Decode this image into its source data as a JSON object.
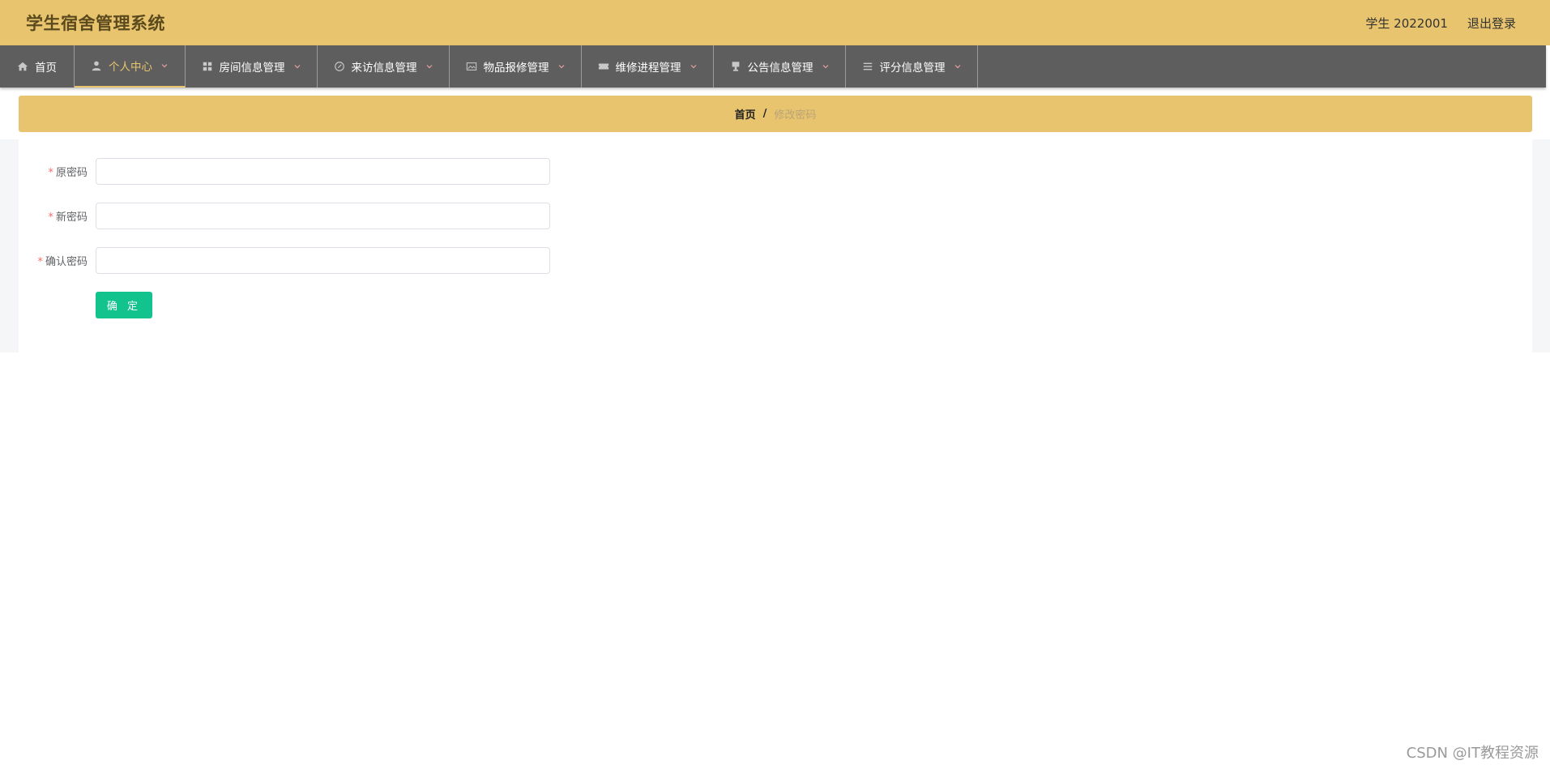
{
  "header": {
    "title": "学生宿舍管理系统",
    "user": "学生 2022001",
    "logout": "退出登录"
  },
  "nav": {
    "items": [
      {
        "label": "首页",
        "icon": "home-icon"
      },
      {
        "label": "个人中心",
        "icon": "user-icon"
      },
      {
        "label": "房间信息管理",
        "icon": "grid-icon"
      },
      {
        "label": "来访信息管理",
        "icon": "compass-icon"
      },
      {
        "label": "物品报修管理",
        "icon": "picture-icon"
      },
      {
        "label": "维修进程管理",
        "icon": "ticket-icon"
      },
      {
        "label": "公告信息管理",
        "icon": "stamp-icon"
      },
      {
        "label": "评分信息管理",
        "icon": "list-icon"
      }
    ]
  },
  "breadcrumb": {
    "home": "首页",
    "separator": "/",
    "current": "修改密码"
  },
  "form": {
    "old_password_label": "原密码",
    "new_password_label": "新密码",
    "confirm_password_label": "确认密码",
    "old_password_value": "",
    "new_password_value": "",
    "confirm_password_value": "",
    "submit_label": "确 定"
  },
  "watermark": "CSDN @IT教程资源",
  "colors": {
    "header_bg": "#e8c46e",
    "nav_bg": "#5e5e5e",
    "active_nav": "#e8c46e",
    "submit_bg": "#12c38e",
    "required": "#f56c6c"
  }
}
